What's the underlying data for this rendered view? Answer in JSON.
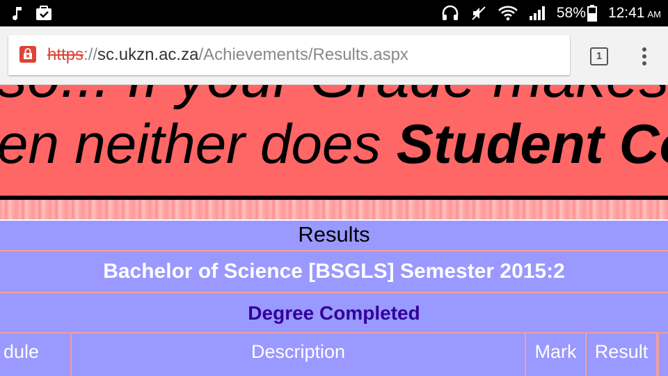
{
  "status_bar": {
    "battery_percent": "58%",
    "time": "12:41",
    "ampm": "AM",
    "left_icons": [
      "music-note-icon",
      "download-task-icon"
    ],
    "right_icons": [
      "headphones-icon",
      "mute-icon",
      "wifi-icon",
      "signal-icon",
      "battery-icon"
    ]
  },
  "browser": {
    "url_scheme": "https",
    "url_sep": "://",
    "url_host": "sc.ukzn.ac.za",
    "url_path": "/Achievements/Results.aspx",
    "tab_count": "1",
    "security_state": "insecure",
    "colors": {
      "insecure_red": "#db4437"
    }
  },
  "banner": {
    "line1": "so... If your Grade makes",
    "line2_plain": "en neither does ",
    "line2_bold": "Student Co",
    "colors": {
      "background": "#ff6666"
    }
  },
  "results": {
    "title": "Results",
    "program": "Bachelor of Science [BSGLS] Semester 2015:2",
    "status": "Degree Completed",
    "columns": [
      "dule",
      "Description",
      "Mark",
      "Result"
    ],
    "colors": {
      "panel": "#9999ff",
      "status_text": "#330099",
      "divider": "#f0a0a0"
    }
  }
}
